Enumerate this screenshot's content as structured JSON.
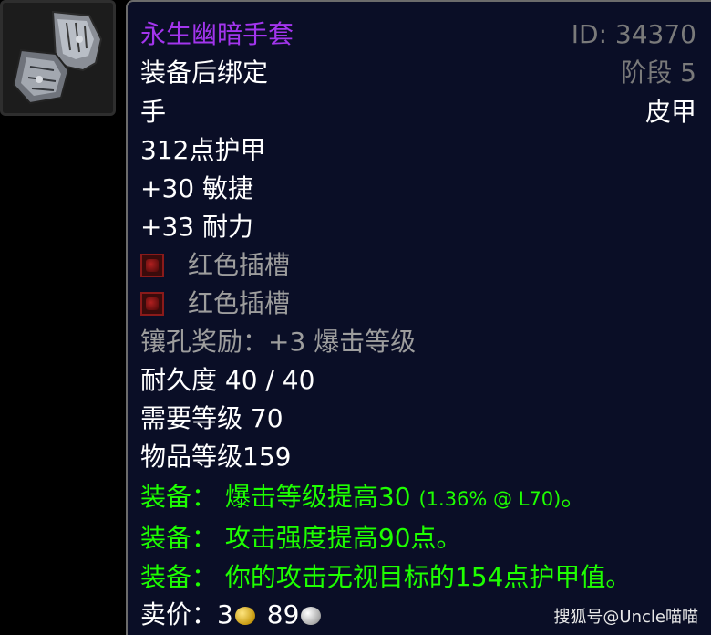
{
  "item": {
    "name": "永生幽暗手套",
    "id_label": "ID: 34370",
    "phase_label": "阶段 5",
    "bind": "装备后绑定",
    "slot": "手",
    "armor_type": "皮甲",
    "armor": "312点护甲",
    "stat_agility": "+30 敏捷",
    "stat_stamina": "+33 耐力",
    "sockets": [
      {
        "label": "红色插槽",
        "color": "#b02020"
      },
      {
        "label": "红色插槽",
        "color": "#b02020"
      }
    ],
    "socket_bonus": "镶孔奖励：+3 爆击等级",
    "durability": "耐久度 40 / 40",
    "required_level": "需要等级 70",
    "item_level": "物品等级159",
    "equip_effects": [
      {
        "prefix": "装备：",
        "text": "爆击等级提高30",
        "note": "(1.36% @ L70)",
        "suffix": "。"
      },
      {
        "prefix": "装备：",
        "text": "攻击强度提高90点。",
        "note": "",
        "suffix": ""
      },
      {
        "prefix": "装备：",
        "text": "你的攻击无视目标的154点护甲值。",
        "note": "",
        "suffix": ""
      }
    ],
    "sell_price": {
      "label": "卖价：",
      "gold": "3",
      "silver": "89"
    },
    "icon": "gauntlet-icon"
  },
  "watermark": "搜狐号@Uncle喵喵",
  "colors": {
    "epic": "#a335ee",
    "green": "#1eff00",
    "tooltip_bg": "#0a0e26",
    "gray": "#9d9d9d"
  }
}
